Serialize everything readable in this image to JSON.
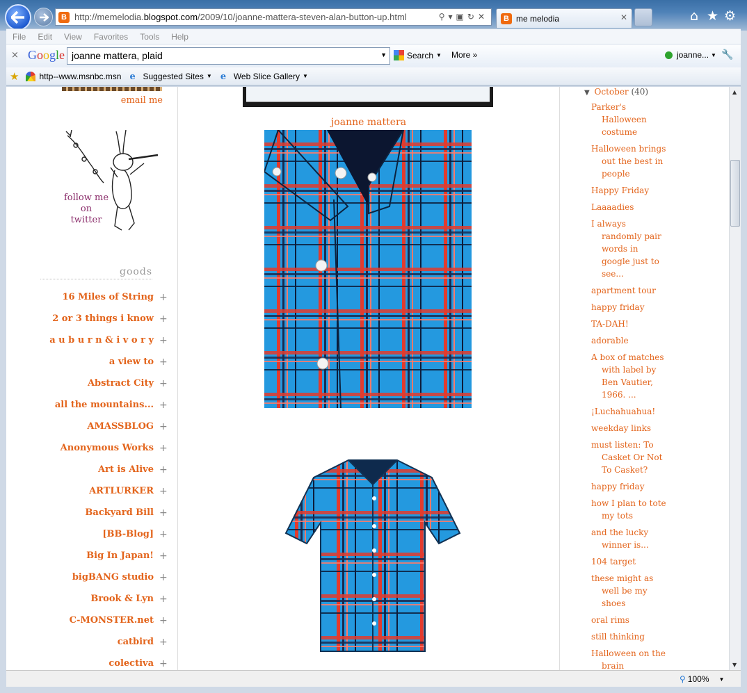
{
  "browser": {
    "url_prefix": "http://memelodia.",
    "url_domain": "blogspot.com",
    "url_suffix": "/2009/10/joanne-mattera-steven-alan-button-up.html",
    "tab_title": "me melodia",
    "menu": [
      "File",
      "Edit",
      "View",
      "Favorites",
      "Tools",
      "Help"
    ],
    "google_bar": {
      "close": "×",
      "logo": "Google",
      "query": "joanne mattera, plaid",
      "search_label": "Search",
      "more_label": "More »",
      "user_label": "joanne..."
    },
    "favorites": {
      "item1": "http--www.msnbc.msn",
      "item2": "Suggested Sites",
      "item3": "Web Slice Gallery"
    },
    "zoom": "100%"
  },
  "sidebar_left": {
    "email_me": "email me",
    "twitter_lines": [
      "follow me",
      "on",
      "twitter"
    ],
    "goods_heading": "goods",
    "goods": [
      "16 Miles of String",
      "2 or 3 things i know",
      "a u b u r n & i v o r y",
      "a view to",
      "Abstract City",
      "all the mountains...",
      "AMASSBLOG",
      "Anonymous Works",
      "Art is Alive",
      "ARTLURKER",
      "Backyard Bill",
      "[BB-Blog]",
      "Big In Japan!",
      "bigBANG studio",
      "Brook & Lyn",
      "C-MONSTER.net",
      "catbird",
      "colectiva"
    ]
  },
  "main": {
    "author_link": "joanne mattera"
  },
  "sidebar_right": {
    "archive_month": "October",
    "archive_count": "(40)",
    "posts": [
      "Parker's Halloween costume",
      "Halloween brings out the best in people",
      "Happy Friday",
      "Laaaadies",
      "I always randomly pair words in google just to see...",
      "apartment tour",
      "happy friday",
      "TA-DAH!",
      "adorable",
      "A box of matches with label by Ben Vautier, 1966. ...",
      "¡Luchahuahua!",
      "weekday links",
      "must listen: To Casket Or Not To Casket?",
      "happy friday",
      "how I plan to tote my tots",
      "and the lucky winner is...",
      "104 target",
      "these might as well be my shoes",
      "oral rims",
      "still thinking",
      "Halloween on the brain"
    ]
  },
  "colors": {
    "link": "#e3641b",
    "muted": "#999999",
    "plaid_blue": "#1e8fd4",
    "plaid_red": "#e23b2e"
  }
}
